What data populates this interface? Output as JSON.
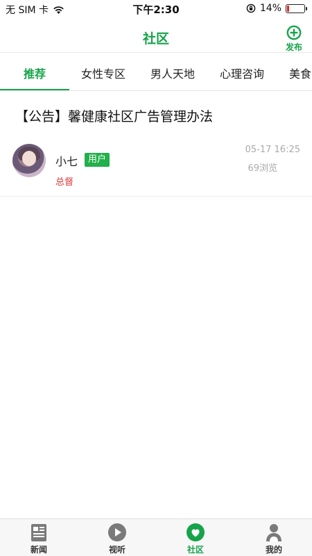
{
  "status_bar": {
    "carrier": "无 SIM 卡",
    "time": "下午2:30",
    "battery_percent": "14%",
    "battery_level": 0.14,
    "wifi_icon": "wifi-icon",
    "orientation_lock_icon": "orientation-lock-icon"
  },
  "header": {
    "title": "社区",
    "publish_label": "发布",
    "publish_icon": "plus-circle-icon"
  },
  "tabs": {
    "items": [
      "推荐",
      "女性专区",
      "男人天地",
      "心理咨询",
      "美食"
    ],
    "active_index": 0
  },
  "posts": [
    {
      "title": "【公告】馨健康社区广告管理办法",
      "author": "小七",
      "badge": "用户",
      "role": "总督",
      "time": "05-17 16:25",
      "views": "69浏览"
    }
  ],
  "tabbar": {
    "items": [
      {
        "label": "新闻",
        "icon": "news-icon"
      },
      {
        "label": "视听",
        "icon": "play-icon"
      },
      {
        "label": "社区",
        "icon": "community-heart-icon"
      },
      {
        "label": "我的",
        "icon": "profile-icon"
      }
    ],
    "active_index": 2
  },
  "colors": {
    "accent": "#16a34a",
    "badge": "#22b04a",
    "role": "#d83a3a",
    "muted": "#aaaaaa",
    "battery_low": "#e0241f"
  }
}
